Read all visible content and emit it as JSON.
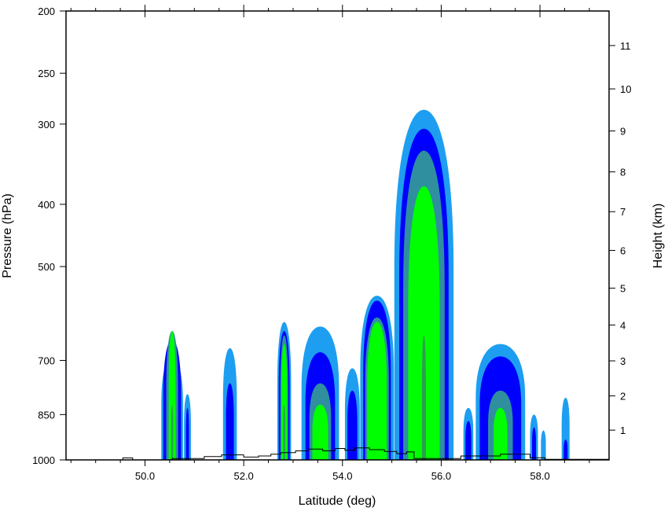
{
  "chart_data": {
    "type": "contour",
    "xlabel": "Latitude (deg)",
    "ylabel": "Pressure (hPa)",
    "y2label": "Height (km)",
    "xlim": [
      48.4,
      59.4
    ],
    "ylim": [
      1000,
      200
    ],
    "y_scale": "log",
    "grid": false,
    "x_ticks": [
      "50.0",
      "52.0",
      "54.0",
      "56.0",
      "58.0"
    ],
    "x_tick_values": [
      50,
      52,
      54,
      56,
      58
    ],
    "y_ticks": [
      "200",
      "250",
      "300",
      "400",
      "500",
      "700",
      "850",
      "1000"
    ],
    "y_tick_values": [
      200,
      250,
      300,
      400,
      500,
      700,
      850,
      1000
    ],
    "y2_ticks": [
      "1",
      "2",
      "3",
      "4",
      "5",
      "6",
      "7",
      "8",
      "9",
      "10",
      "11"
    ],
    "y2_tick_values": [
      1,
      2,
      3,
      4,
      5,
      6,
      7,
      8,
      9,
      10,
      11
    ],
    "fill_levels": [
      {
        "level": 1,
        "color": "#1e9ef0"
      },
      {
        "level": 2,
        "color": "#0000ff"
      },
      {
        "level": 3,
        "color": "#2f8f9f"
      },
      {
        "level": 4,
        "color": "#00ff00"
      },
      {
        "level": 5,
        "color": "#2e9e4e"
      }
    ],
    "cells": [
      {
        "center": 50.55,
        "halfwidth": [
          0.22,
          0.18,
          0.12,
          0.07,
          0.02
        ],
        "top": [
          690,
          650,
          630,
          630,
          820
        ]
      },
      {
        "center": 50.86,
        "halfwidth": [
          0.07,
          0.03
        ],
        "top": [
          790,
          830
        ]
      },
      {
        "center": 51.72,
        "halfwidth": [
          0.14,
          0.08
        ],
        "top": [
          670,
          760
        ]
      },
      {
        "center": 52.82,
        "halfwidth": [
          0.14,
          0.11,
          0.08,
          0.06,
          0.02
        ],
        "top": [
          610,
          630,
          640,
          660,
          820
        ]
      },
      {
        "center": 53.55,
        "halfwidth": [
          0.38,
          0.3,
          0.22,
          0.16
        ],
        "top": [
          620,
          680,
          760,
          820
        ]
      },
      {
        "center": 54.2,
        "halfwidth": [
          0.15,
          0.1
        ],
        "top": [
          720,
          780
        ]
      },
      {
        "center": 54.7,
        "halfwidth": [
          0.34,
          0.28,
          0.24,
          0.2
        ],
        "top": [
          555,
          565,
          600,
          610
        ]
      },
      {
        "center": 55.65,
        "halfwidth": [
          0.6,
          0.5,
          0.42,
          0.32,
          0.04
        ],
        "top": [
          285,
          305,
          330,
          375,
          640
        ]
      },
      {
        "center": 56.55,
        "halfwidth": [
          0.1,
          0.06
        ],
        "top": [
          830,
          870
        ]
      },
      {
        "center": 57.2,
        "halfwidth": [
          0.5,
          0.42,
          0.25,
          0.14
        ],
        "top": [
          660,
          690,
          780,
          830
        ]
      },
      {
        "center": 57.88,
        "halfwidth": [
          0.08,
          0.04
        ],
        "top": [
          850,
          890
        ]
      },
      {
        "center": 58.07,
        "halfwidth": [
          0.05
        ],
        "top": [
          900
        ]
      },
      {
        "center": 58.52,
        "halfwidth": [
          0.08,
          0.04
        ],
        "top": [
          800,
          930
        ]
      }
    ],
    "terrain": {
      "lat": [
        48.4,
        49.55,
        49.55,
        49.75,
        49.75,
        50.55,
        50.55,
        51.2,
        51.2,
        51.55,
        51.55,
        52.0,
        52.0,
        52.3,
        52.3,
        52.55,
        52.55,
        52.75,
        52.75,
        53.05,
        53.05,
        53.3,
        53.3,
        53.6,
        53.6,
        53.85,
        53.85,
        54.05,
        54.05,
        54.25,
        54.25,
        54.55,
        54.55,
        54.85,
        54.85,
        55.1,
        55.1,
        55.3,
        55.3,
        55.45,
        55.45,
        56.4,
        56.4,
        57.2,
        57.2,
        57.8,
        57.8,
        58.1,
        58.1,
        59.4
      ],
      "pressure": [
        1000,
        1000,
        993,
        993,
        1000,
        1000,
        995,
        995,
        988,
        988,
        982,
        982,
        990,
        990,
        986,
        986,
        980,
        980,
        974,
        974,
        968,
        968,
        962,
        962,
        968,
        968,
        960,
        960,
        966,
        966,
        958,
        958,
        964,
        964,
        970,
        970,
        978,
        978,
        972,
        972,
        995,
        995,
        986,
        986,
        980,
        980,
        992,
        992,
        998,
        998
      ]
    }
  }
}
